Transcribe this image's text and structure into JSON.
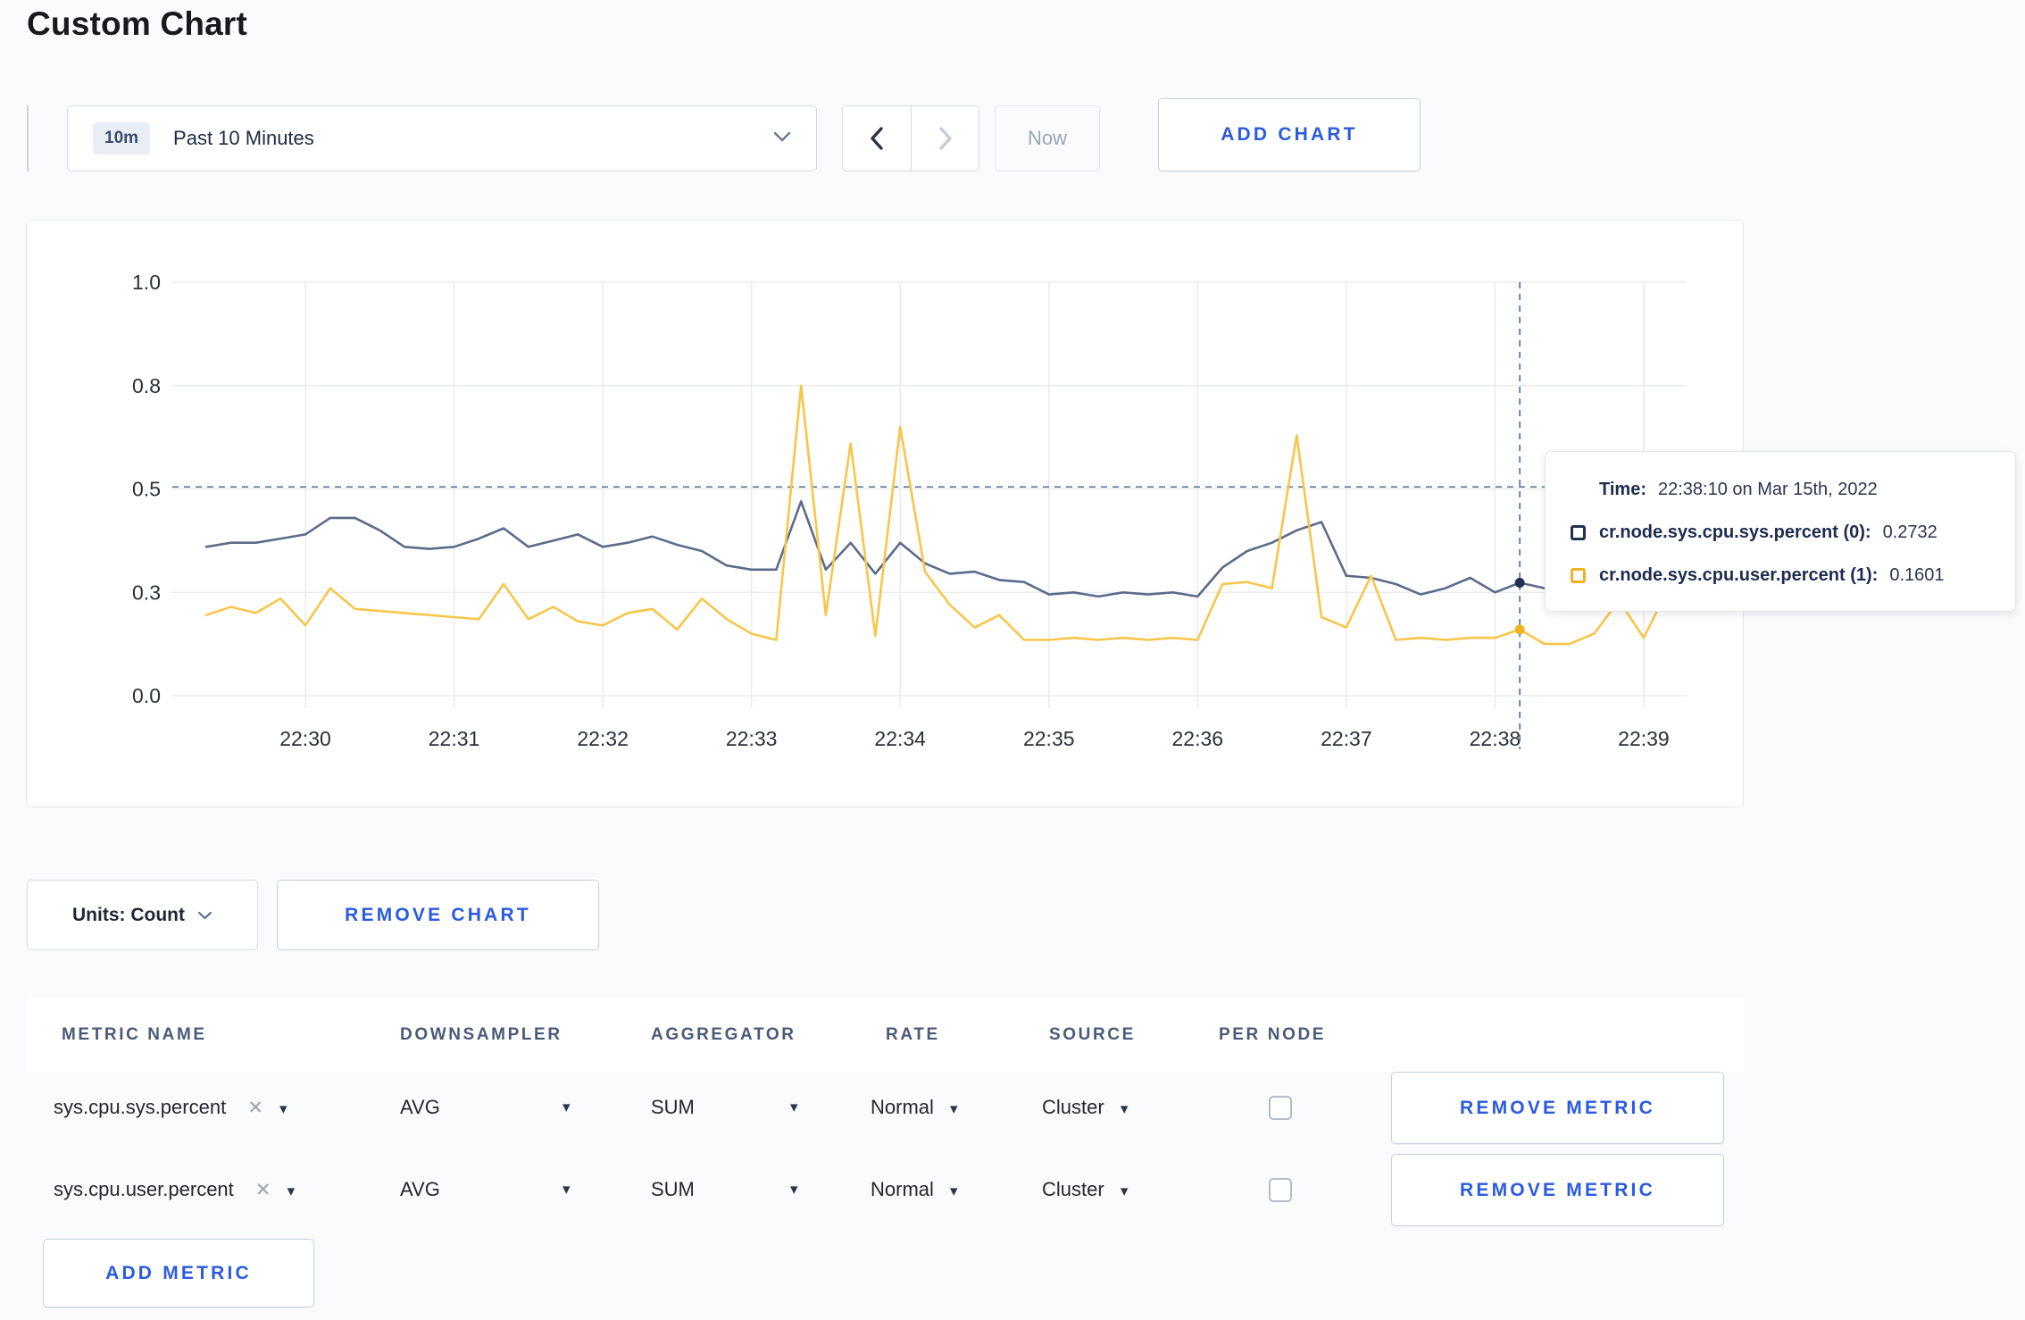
{
  "page": {
    "title": "Custom Chart",
    "background": "#fafbfc",
    "accent_blue": "#2b5adf"
  },
  "toolbar": {
    "timescale": {
      "badge": "10m",
      "label": "Past 10 Minutes"
    },
    "now_label": "Now",
    "add_chart_label": "ADD CHART"
  },
  "chart_data": {
    "type": "line",
    "x_tick_labels": [
      "22:30",
      "22:31",
      "22:32",
      "22:33",
      "22:34",
      "22:35",
      "22:36",
      "22:37",
      "22:38",
      "22:39"
    ],
    "y_tick_labels": [
      "1.0",
      "0.8",
      "0.5",
      "0.3",
      "0.0"
    ],
    "y_tick_values": [
      1.0,
      0.75,
      0.5,
      0.25,
      0.0
    ],
    "ylim": [
      0,
      1
    ],
    "grid": true,
    "x_start_offset_sec": -40,
    "x_step_sec": 10,
    "series": [
      {
        "name": "cr.node.sys.cpu.sys.percent (0)",
        "color": "#5c6b88",
        "swatch": "#223053",
        "values": [
          0.36,
          0.37,
          0.37,
          0.38,
          0.39,
          0.43,
          0.43,
          0.4,
          0.36,
          0.355,
          0.36,
          0.38,
          0.405,
          0.36,
          0.375,
          0.39,
          0.36,
          0.37,
          0.385,
          0.365,
          0.35,
          0.315,
          0.305,
          0.305,
          0.47,
          0.305,
          0.37,
          0.295,
          0.37,
          0.32,
          0.295,
          0.3,
          0.28,
          0.275,
          0.245,
          0.25,
          0.24,
          0.25,
          0.245,
          0.25,
          0.24,
          0.31,
          0.35,
          0.37,
          0.4,
          0.42,
          0.29,
          0.285,
          0.27,
          0.245,
          0.26,
          0.285,
          0.25,
          0.2732,
          0.26,
          0.27,
          0.285,
          0.275,
          0.285,
          0.295
        ]
      },
      {
        "name": "cr.node.sys.cpu.user.percent (1)",
        "color": "#f7c64a",
        "swatch": "#f0b322",
        "values": [
          0.195,
          0.215,
          0.2,
          0.235,
          0.17,
          0.26,
          0.21,
          0.205,
          0.2,
          0.195,
          0.19,
          0.185,
          0.27,
          0.185,
          0.215,
          0.18,
          0.17,
          0.2,
          0.21,
          0.16,
          0.235,
          0.185,
          0.15,
          0.135,
          0.75,
          0.195,
          0.61,
          0.145,
          0.65,
          0.3,
          0.22,
          0.165,
          0.195,
          0.135,
          0.135,
          0.14,
          0.135,
          0.14,
          0.135,
          0.14,
          0.135,
          0.27,
          0.275,
          0.26,
          0.63,
          0.19,
          0.165,
          0.29,
          0.135,
          0.14,
          0.135,
          0.14,
          0.14,
          0.1601,
          0.125,
          0.125,
          0.15,
          0.23,
          0.14,
          0.26
        ]
      }
    ],
    "crosshair": {
      "time_offset_sec": 490,
      "hline_value": 0.505,
      "dash_color": "#5c7a99"
    }
  },
  "tooltip": {
    "time_label": "Time:",
    "time_value": "22:38:10 on Mar 15th, 2022",
    "rows": [
      {
        "label": "cr.node.sys.cpu.sys.percent (0):",
        "value": "0.2732",
        "swatch": "#223053"
      },
      {
        "label": "cr.node.sys.cpu.user.percent (1):",
        "value": "0.1601",
        "swatch": "#f0b322"
      }
    ]
  },
  "chart_controls": {
    "units_label": "Units: Count",
    "remove_chart_label": "REMOVE CHART"
  },
  "metrics_table": {
    "headers": [
      "METRIC NAME",
      "DOWNSAMPLER",
      "AGGREGATOR",
      "RATE",
      "SOURCE",
      "PER NODE"
    ],
    "rows": [
      {
        "metric": "sys.cpu.sys.percent",
        "downsampler": "AVG",
        "aggregator": "SUM",
        "rate": "Normal",
        "source": "Cluster",
        "per_node_checked": false,
        "remove_label": "REMOVE METRIC"
      },
      {
        "metric": "sys.cpu.user.percent",
        "downsampler": "AVG",
        "aggregator": "SUM",
        "rate": "Normal",
        "source": "Cluster",
        "per_node_checked": false,
        "remove_label": "REMOVE METRIC"
      }
    ],
    "add_metric_label": "ADD METRIC"
  }
}
